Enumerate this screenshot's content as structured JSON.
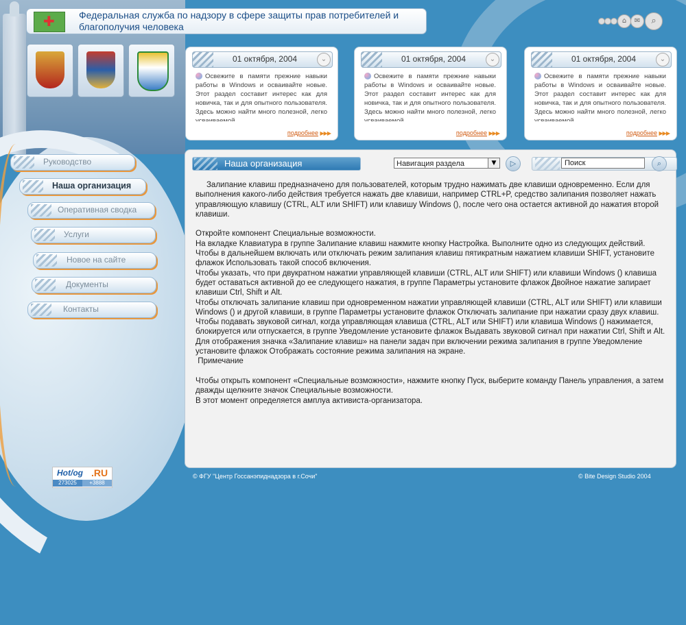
{
  "header": {
    "title": "Федеральная служба по надзору в сфере защиты прав потребителей и благополучия человека"
  },
  "emblems": [
    {
      "name": "emblem-russia"
    },
    {
      "name": "emblem-krasnodar-krai"
    },
    {
      "name": "emblem-sochi"
    }
  ],
  "news": [
    {
      "date": "01 октября, 2004",
      "text": "Освежите в памяти прежние навыки работы в Windows и осваивайте новые. Этот раздел составит интерес как для новичка, так и для опытного пользователя. Здесь можно найти много полезной, легко усваиваемой",
      "more": "подробнее"
    },
    {
      "date": "01 октября, 2004",
      "text": "Освежите в памяти прежние навыки работы в Windows и осваивайте новые. Этот раздел составит интерес как для новичка, так и для опытного пользователя. Здесь можно найти много полезной, легко усваиваемой",
      "more": "подробнее"
    },
    {
      "date": "01 октября, 2004",
      "text": "Освежите в памяти прежние навыки работы в Windows и осваивайте новые. Этот раздел составит интерес как для новичка, так и для опытного пользователя. Здесь можно найти много полезной, легко усваиваемой",
      "more": "подробнее"
    }
  ],
  "menu": [
    {
      "label": "Руководство",
      "active": false
    },
    {
      "label": "Наша организация",
      "active": true
    },
    {
      "label": "Оперативная сводка",
      "active": false
    },
    {
      "label": "Услуги",
      "active": false
    },
    {
      "label": "Новое на сайте",
      "active": false
    },
    {
      "label": "Документы",
      "active": false
    },
    {
      "label": "Контакты",
      "active": false
    }
  ],
  "main": {
    "title": "Наша организация",
    "nav_select": "Навигация раздела",
    "search_placeholder": "Поиск",
    "paragraphs": [
      "     Залипание клавиш предназначено для пользователей, которым трудно нажимать две клавиши одновременно. Если для выполнения какого-либо действия требуется нажать две клавиши, например CTRL+P, средство залипания позволяет нажать управляющую клавишу (CTRL, ALT или SHIFT) или клавишу Windows (), после чего она остается активной до нажатия второй клавиши.",
      "",
      "Откройте компонент Специальные возможности.",
      "На вкладке Клавиатура в группе Залипание клавиш нажмите кнопку Настройка. Выполните одно из следующих действий.",
      "Чтобы в дальнейшем включать или отключать режим залипания клавиш пятикратным нажатием клавиши SHIFT, установите флажок Использовать такой способ включения.",
      "Чтобы указать, что при двукратном нажатии управляющей клавиши (CTRL, ALT или SHIFT) или клавиши Windows () клавиша будет оставаться активной до ее следующего нажатия, в группе Параметры установите флажок Двойное нажатие запирает клавиши Ctrl, Shift и Alt.",
      "Чтобы отключать залипание клавиш при одновременном нажатии управляющей клавиши (CTRL, ALT или SHIFT) или клавиши Windows () и другой клавиши, в группе Параметры установите флажок Отключать залипание при нажатии сразу двух клавиш.",
      "Чтобы подавать звуковой сигнал, когда управляющая клавиша (CTRL, ALT или SHIFT) или клавиша Windows () нажимается, блокируется или отпускается, в группе Уведомление установите флажок Выдавать звуковой сигнал при нажатии Ctrl, Shift и Alt.",
      "Для отображения значка «Залипание клавиш» на панели задач при включении режима залипания в группе Уведомление установите флажок Отображать состояние режима залипания на экране.",
      " Примечание",
      "",
      "Чтобы открыть компонент «Специальные возможности», нажмите кнопку Пуск, выберите команду Панель управления, а затем дважды щелкните значок Специальные возможности.",
      "В этот момент определяется амплуа активиста-организатора."
    ]
  },
  "counter": {
    "logo": "Hot",
    "logo2": "og",
    "ru": ".RU",
    "hits": "273025",
    "today": "+3888"
  },
  "footer": {
    "left": "© ФГУ \"Центр Госсанэпиднадзора в г.Сочи\"",
    "right": "© Bite Design Studio 2004"
  },
  "colors": {
    "background": "#3d8ec0",
    "accent_orange": "#e8973d",
    "link": "#d05a10"
  },
  "icons": {
    "top_bar": [
      "dot",
      "dot",
      "dot",
      "home-icon",
      "mail-icon",
      "search-icon"
    ],
    "news_expand": "chevron-down-icon",
    "nav_go": "arrow-right-icon",
    "search_go": "search-icon"
  }
}
